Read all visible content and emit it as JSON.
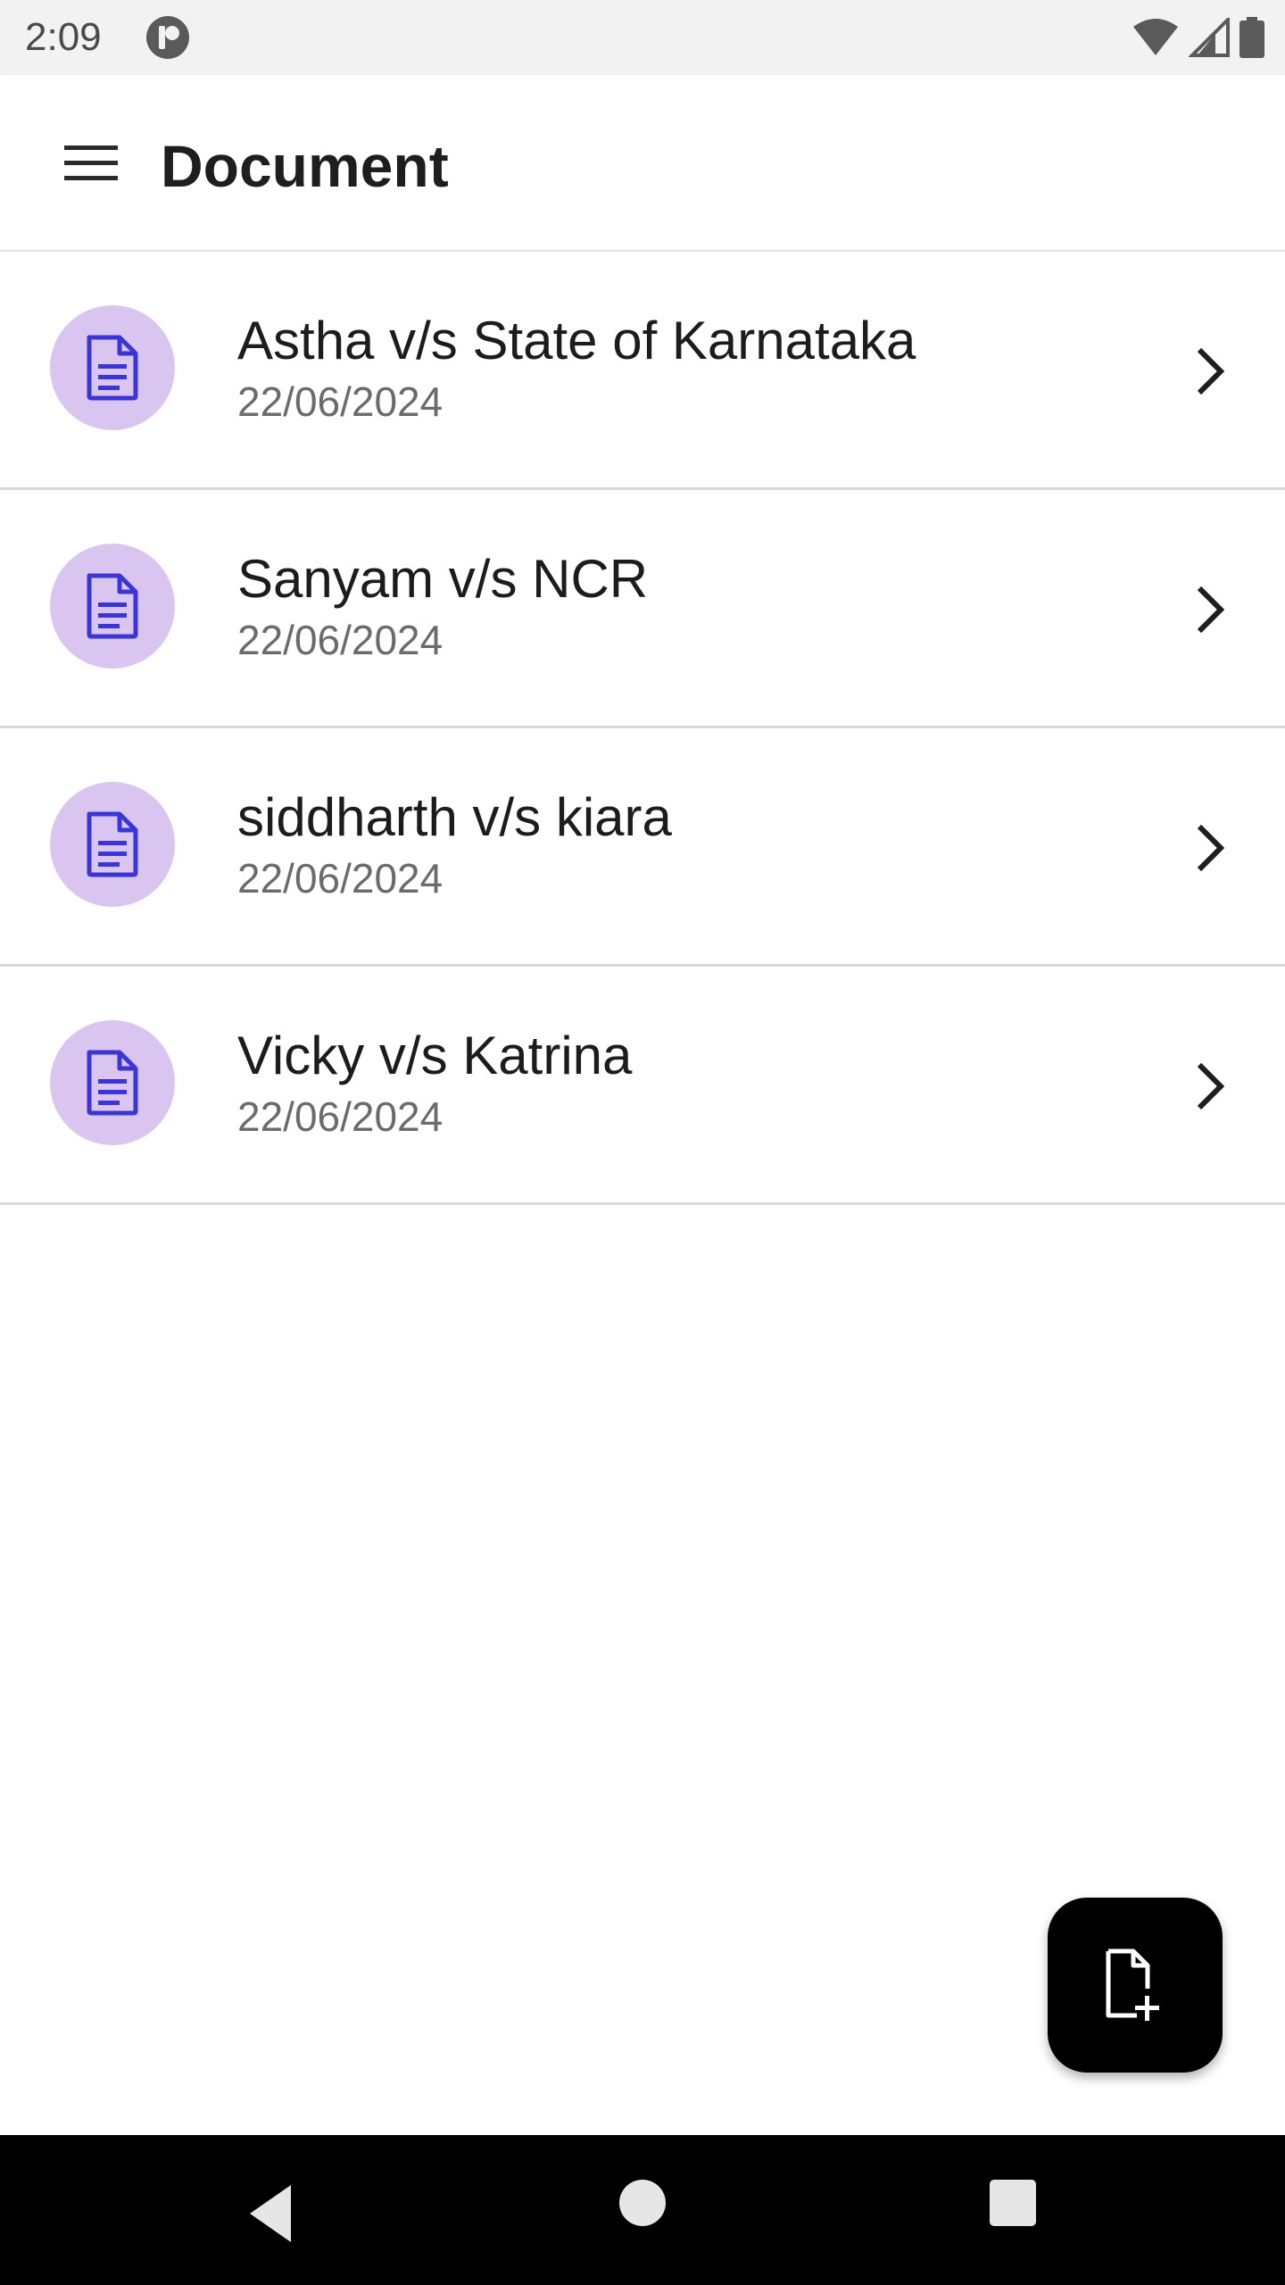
{
  "status_bar": {
    "time": "2:09",
    "icons": [
      "app-notification-icon",
      "wifi-icon",
      "cellular-signal-icon",
      "battery-icon"
    ]
  },
  "app_bar": {
    "title": "Document",
    "menu_icon": "hamburger-menu-icon"
  },
  "documents": [
    {
      "title": "Astha v/s State of Karnataka",
      "date": "22/06/2024",
      "icon": "document-icon"
    },
    {
      "title": "Sanyam v/s NCR",
      "date": "22/06/2024",
      "icon": "document-icon"
    },
    {
      "title": "siddharth v/s kiara",
      "date": "22/06/2024",
      "icon": "document-icon"
    },
    {
      "title": "Vicky v/s Katrina",
      "date": "22/06/2024",
      "icon": "document-icon"
    }
  ],
  "fab": {
    "icon": "add-document-icon"
  },
  "nav_bar": {
    "icons": [
      "back-icon",
      "home-icon",
      "recents-icon"
    ]
  },
  "colors": {
    "avatar_bg": "#d9c5f0",
    "doc_icon": "#3b35d6",
    "fab_bg": "#000000",
    "status_bar_bg": "#f2f2f2"
  }
}
